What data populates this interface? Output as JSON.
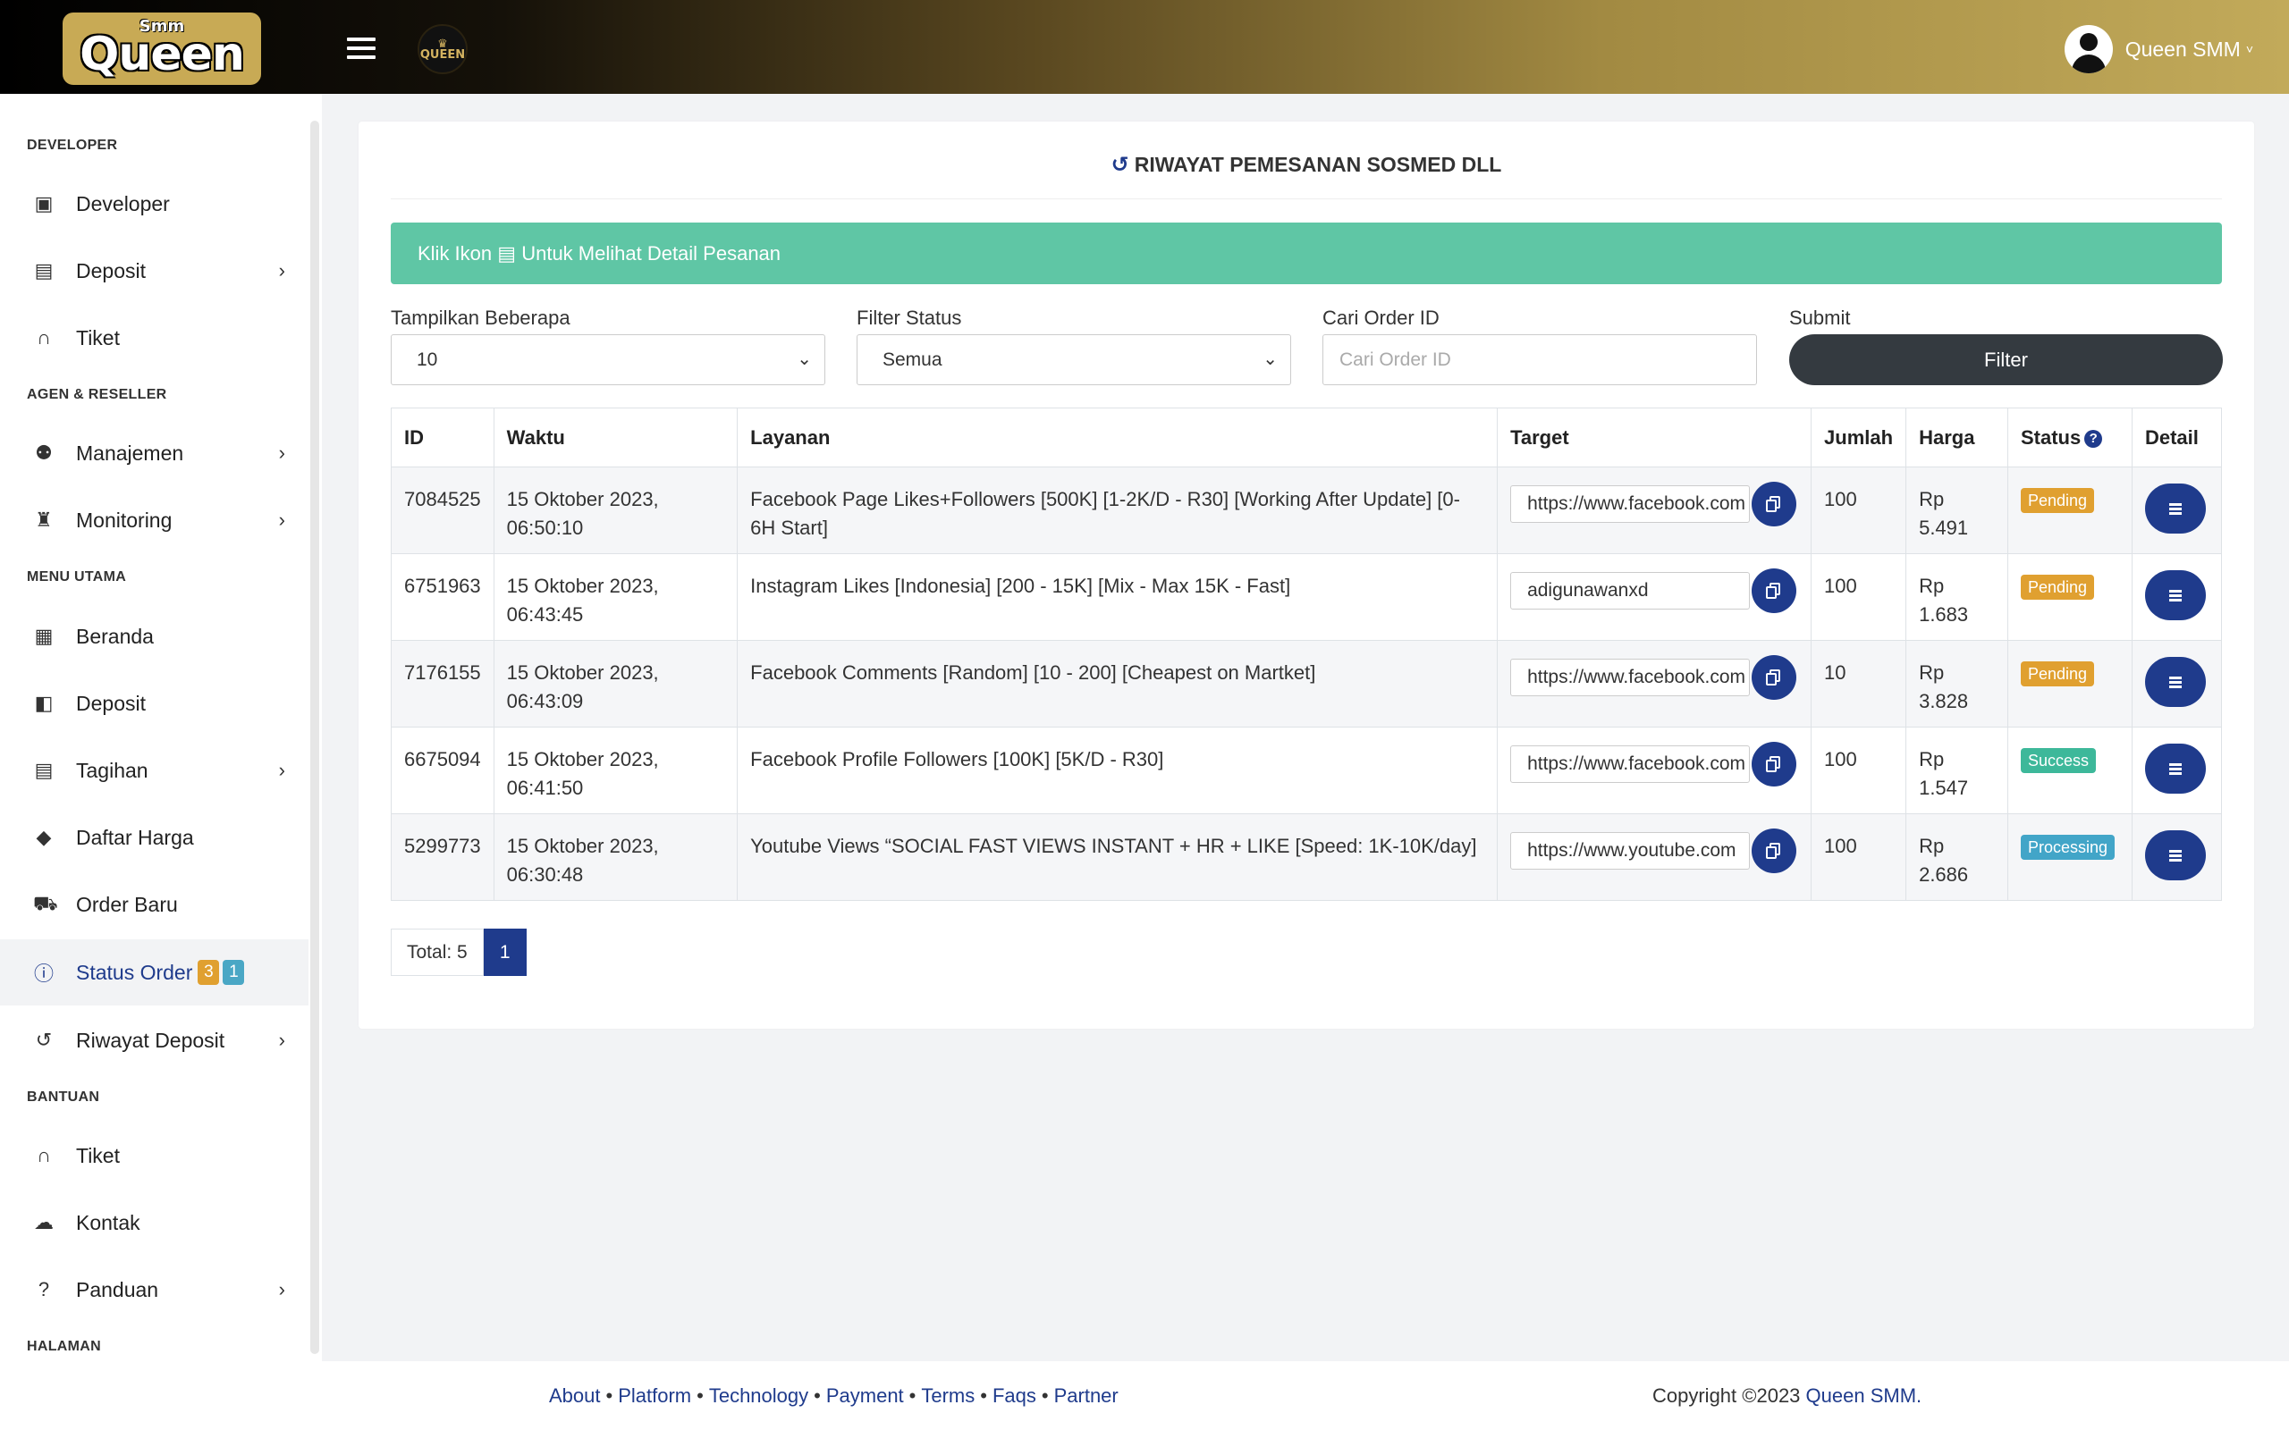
{
  "brand": {
    "logo_top": "Smm",
    "logo_main": "Queen",
    "mini_logo_text": "QUEEN"
  },
  "topbar": {
    "user_name": "Queen SMM",
    "user_caret": "˅"
  },
  "sidebar": {
    "sections": [
      {
        "header": "DEVELOPER"
      },
      {
        "header": "AGEN & RESELLER"
      },
      {
        "header": "MENU UTAMA"
      },
      {
        "header": "BANTUAN"
      },
      {
        "header": "HALAMAN"
      }
    ],
    "items": [
      {
        "label": "Developer",
        "icon": "terminal-icon",
        "arrow": ""
      },
      {
        "label": "Deposit",
        "icon": "file-icon",
        "arrow": "›"
      },
      {
        "label": "Tiket",
        "icon": "headset-icon",
        "arrow": ""
      },
      {
        "label": "Manajemen",
        "icon": "users-icon",
        "arrow": "›"
      },
      {
        "label": "Monitoring",
        "icon": "trophy-icon",
        "arrow": "›"
      },
      {
        "label": "Beranda",
        "icon": "dashboard-icon",
        "arrow": ""
      },
      {
        "label": "Deposit",
        "icon": "wallet-icon",
        "arrow": ""
      },
      {
        "label": "Tagihan",
        "icon": "invoice-icon",
        "arrow": "›"
      },
      {
        "label": "Daftar Harga",
        "icon": "tags-icon",
        "arrow": ""
      },
      {
        "label": "Order Baru",
        "icon": "cart-icon",
        "arrow": ""
      },
      {
        "label": "Status Order",
        "icon": "info-icon",
        "arrow": "",
        "badges": [
          "3",
          "1"
        ]
      },
      {
        "label": "Riwayat Deposit",
        "icon": "history-icon",
        "arrow": "›"
      },
      {
        "label": "Tiket",
        "icon": "headset-icon",
        "arrow": ""
      },
      {
        "label": "Kontak",
        "icon": "comments-icon",
        "arrow": ""
      },
      {
        "label": "Panduan",
        "icon": "question-icon",
        "arrow": "›"
      }
    ]
  },
  "page": {
    "title": "RIWAYAT PEMESANAN SOSMED DLL",
    "alert_prefix": "Klik Ikon",
    "alert_suffix": "Untuk Melihat Detail Pesanan",
    "filters": {
      "show_label": "Tampilkan Beberapa",
      "show_value": "10",
      "status_label": "Filter Status",
      "status_value": "Semua",
      "search_label": "Cari Order ID",
      "search_placeholder": "Cari Order ID",
      "submit_label": "Submit",
      "submit_button": "Filter"
    },
    "table": {
      "headers": [
        "ID",
        "Waktu",
        "Layanan",
        "Target",
        "Jumlah",
        "Harga",
        "Status",
        "Detail"
      ],
      "rows": [
        {
          "id": "7084525",
          "time": "15 Oktober 2023, 06:50:10",
          "service": "Facebook Page Likes+Followers [500K] [1-2K/D - R30] [Working After Update] [0-6H Start]",
          "target": "https://www.facebook.com",
          "qty": "100",
          "price": "Rp 5.491",
          "status": "Pending"
        },
        {
          "id": "6751963",
          "time": "15 Oktober 2023, 06:43:45",
          "service": "Instagram Likes [Indonesia] [200 - 15K] [Mix - Max 15K - Fast]",
          "target": "adigunawanxd",
          "qty": "100",
          "price": "Rp 1.683",
          "status": "Pending"
        },
        {
          "id": "7176155",
          "time": "15 Oktober 2023, 06:43:09",
          "service": "Facebook Comments [Random] [10 - 200] [Cheapest on Martket]",
          "target": "https://www.facebook.com",
          "qty": "10",
          "price": "Rp 3.828",
          "status": "Pending"
        },
        {
          "id": "6675094",
          "time": "15 Oktober 2023, 06:41:50",
          "service": "Facebook Profile Followers [100K] [5K/D - R30]",
          "target": "https://www.facebook.com",
          "qty": "100",
          "price": "Rp 1.547",
          "status": "Success"
        },
        {
          "id": "5299773",
          "time": "15 Oktober 2023, 06:30:48",
          "service": "Youtube Views “SOCIAL FAST VIEWS INSTANT + HR + LIKE [Speed: 1K-10K/day]",
          "target": "https://www.youtube.com",
          "qty": "100",
          "price": "Rp 2.686",
          "status": "Processing"
        }
      ]
    },
    "pagination": {
      "total": "Total: 5",
      "current": "1"
    }
  },
  "footer": {
    "links": [
      "About",
      "Platform",
      "Technology",
      "Payment",
      "Terms",
      "Faqs",
      "Partner"
    ],
    "separator": "•",
    "copyright_prefix": "Copyright ©2023",
    "copyright_brand": "Queen SMM."
  },
  "colors": {
    "primary": "#1f3b8c",
    "alert": "#5fc6a5",
    "pending": "#e0a030",
    "success": "#3db89a",
    "processing": "#42a5c8",
    "badge_warning": "#e0a030",
    "badge_info": "#4aa7c5",
    "dark_button": "#343a40"
  }
}
